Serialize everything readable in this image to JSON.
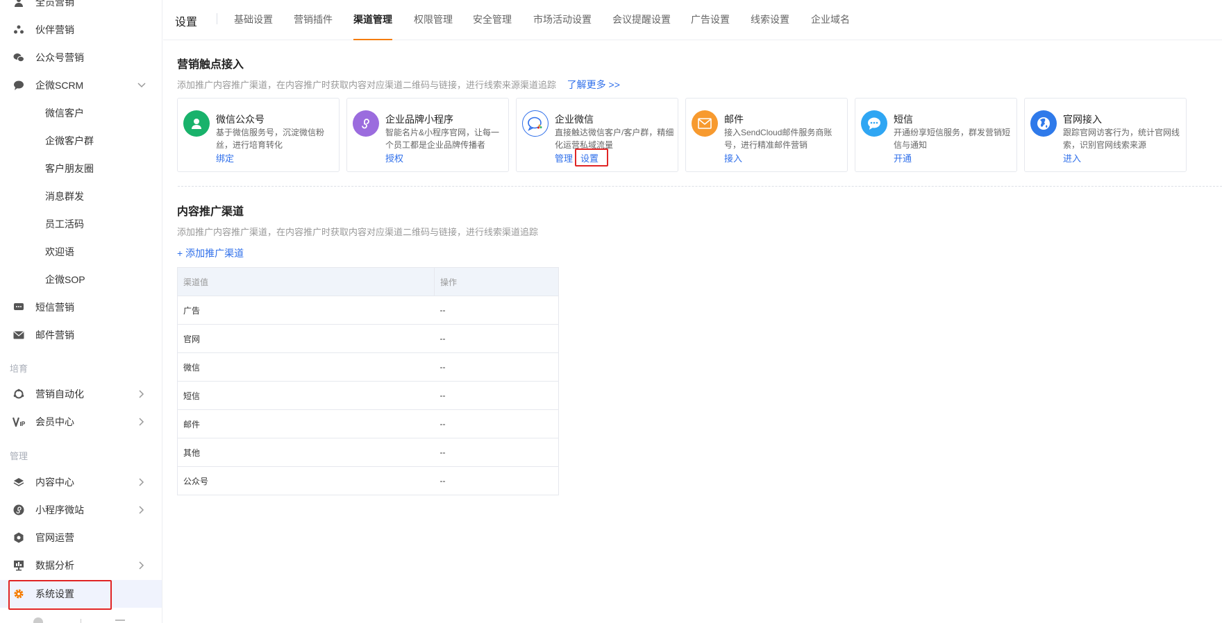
{
  "sidebar": {
    "items": [
      {
        "label": "全员营销",
        "icon": "person-icon"
      },
      {
        "label": "伙伴营销",
        "icon": "partners-icon"
      },
      {
        "label": "公众号营销",
        "icon": "wechat-icon"
      },
      {
        "label": "企微SCRM",
        "icon": "chat-bubble-icon"
      },
      {
        "label": "微信客户"
      },
      {
        "label": "企微客户群"
      },
      {
        "label": "客户朋友圈"
      },
      {
        "label": "消息群发"
      },
      {
        "label": "员工活码"
      },
      {
        "label": "欢迎语"
      },
      {
        "label": "企微SOP"
      },
      {
        "label": "短信营销",
        "icon": "sms-icon"
      },
      {
        "label": "邮件营销",
        "icon": "mail-icon"
      },
      {
        "label": "营销自动化",
        "icon": "automation-icon"
      },
      {
        "label": "会员中心",
        "icon": "vip-icon"
      },
      {
        "label": "内容中心",
        "icon": "layers-icon"
      },
      {
        "label": "小程序微站",
        "icon": "miniprogram-icon"
      },
      {
        "label": "官网运营",
        "icon": "hexagon-icon"
      },
      {
        "label": "数据分析",
        "icon": "chart-icon"
      },
      {
        "label": "系统设置",
        "icon": "gear-icon"
      }
    ],
    "section_titles": [
      "培育",
      "管理"
    ]
  },
  "header": {
    "title": "设置",
    "tabs": [
      "基础设置",
      "营销插件",
      "渠道管理",
      "权限管理",
      "安全管理",
      "市场活动设置",
      "会议提醒设置",
      "广告设置",
      "线索设置",
      "企业域名"
    ],
    "active_tab": "渠道管理"
  },
  "touchpoints": {
    "title": "营销触点接入",
    "desc": "添加推广内容推广渠道，在内容推广时获取内容对应渠道二维码与链接，进行线索来源渠道追踪",
    "learn_more": "了解更多 >>",
    "cards": [
      {
        "title": "微信公众号",
        "desc": "基于微信服务号，沉淀微信粉丝，进行培育转化",
        "actions": [
          "绑定"
        ],
        "icon": "person-icon",
        "color": "#19b26b"
      },
      {
        "title": "企业品牌小程序",
        "desc": "智能名片&小程序官网，让每一个员工都是企业品牌传播者",
        "actions": [
          "授权"
        ],
        "icon": "miniprogram-icon",
        "color": "#9b6cde"
      },
      {
        "title": "企业微信",
        "desc": "直接触达微信客户/客户群，精细化运营私域流量",
        "actions": [
          "管理",
          "设置"
        ],
        "icon": "wecom-icon",
        "color": "#ffffff"
      },
      {
        "title": "邮件",
        "desc": "接入SendCloud邮件服务商账号，进行精准邮件营销",
        "actions": [
          "接入"
        ],
        "icon": "mail-icon",
        "color": "#f79a2f"
      },
      {
        "title": "短信",
        "desc": "开通纷享短信服务，群发营销短信与通知",
        "actions": [
          "开通"
        ],
        "icon": "sms-icon",
        "color": "#2fa6f3"
      },
      {
        "title": "官网接入",
        "desc": "跟踪官网访客行为，统计官网线索，识别官网线索来源",
        "actions": [
          "进入"
        ],
        "icon": "globe-icon",
        "color": "#2f7aea"
      }
    ]
  },
  "channels": {
    "title": "内容推广渠道",
    "desc": "添加推广内容推广渠道，在内容推广时获取内容对应渠道二维码与链接，进行线索渠道追踪",
    "add_label": "+ 添加推广渠道",
    "columns": [
      "渠道值",
      "操作"
    ],
    "rows": [
      {
        "name": "广告",
        "op": "--"
      },
      {
        "name": "官网",
        "op": "--"
      },
      {
        "name": "微信",
        "op": "--"
      },
      {
        "name": "短信",
        "op": "--"
      },
      {
        "name": "邮件",
        "op": "--"
      },
      {
        "name": "其他",
        "op": "--"
      },
      {
        "name": "公众号",
        "op": "--"
      }
    ]
  }
}
